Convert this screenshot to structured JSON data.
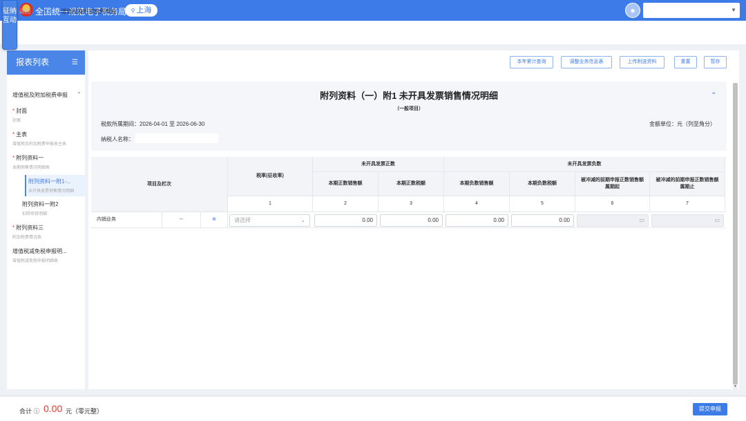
{
  "header": {
    "side_tab": "征纳互动",
    "app_title": "全国统一规范电子税务局",
    "region": "上海",
    "user_name": ""
  },
  "breadcrumb": {
    "back": "返回",
    "home": "首页",
    "separator": ">",
    "current": "增值税及附加税费申报"
  },
  "sidebar": {
    "title": "报表列表",
    "group": "增值税及附加税费申报",
    "items": [
      {
        "name": "封面",
        "sub": "封面",
        "required": true
      },
      {
        "name": "主表",
        "sub": "增值税及附加税费申报表主表",
        "required": true
      },
      {
        "name": "附列资料一",
        "sub": "本期销售情况明细表",
        "required": true
      },
      {
        "name": "附列资料一附1-...",
        "sub": "未开具发票销售情况明细",
        "required": false
      },
      {
        "name": "附列资料一附2",
        "sub": "扣除项目明细",
        "required": false
      },
      {
        "name": "附列资料三",
        "sub": "附加税费情况表",
        "required": true
      },
      {
        "name": "增值税减免税申报明...",
        "sub": "增值税减免税申报明细表",
        "required": false
      }
    ]
  },
  "toolbar": {
    "buttons": [
      "本年累计查询",
      "调整业务信息表",
      "上传附送资料",
      "重置",
      "暂存"
    ]
  },
  "form": {
    "title": "附列资料（一）附1 未开具发票销售情况明细",
    "subtitle": "（一般项目）",
    "period_label": "税款所属期间：",
    "period_value": "2026-04-01 至 2026-06-30",
    "unit": "金额单位：元（列至角分）",
    "taxpayer_label": "纳税人名称："
  },
  "table": {
    "col_item": "项目及栏次",
    "col_rate": "税率(征收率)",
    "group_positive": "未开具发票正数",
    "group_negative": "未开具发票负数",
    "headers": [
      "本期正数销售额",
      "本期正数税额",
      "本期负数销售额",
      "本期负数税额",
      "被冲减的前期申报正数销售额属期起",
      "被冲减的前期申报正数销售额属期止"
    ],
    "col_numbers": [
      "1",
      "2",
      "3",
      "4",
      "5",
      "6",
      "7"
    ],
    "row": {
      "label": "内销业务",
      "dash": "--",
      "rate_placeholder": "请选择",
      "values": [
        "0.00",
        "0.00",
        "0.00",
        "0.00"
      ]
    }
  },
  "footer": {
    "total_label": "合计 ⓘ",
    "total_amount": "0.00",
    "total_unit": "元（零元整）",
    "submit": "提交申报"
  },
  "colors": {
    "primary": "#3d7be9",
    "danger": "#e53935"
  }
}
